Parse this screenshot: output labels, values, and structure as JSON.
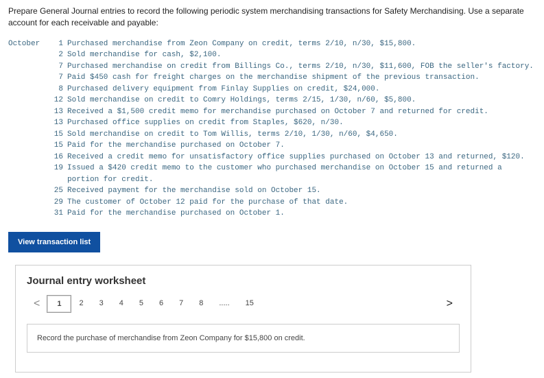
{
  "intro": "Prepare General Journal entries to record the following periodic system merchandising transactions for Safety Merchandising. Use a separate account for each receivable and payable:",
  "transactions": [
    {
      "month": "October",
      "day": "1",
      "text": "Purchased merchandise from Zeon Company on credit, terms 2/10, n/30, $15,800."
    },
    {
      "month": "",
      "day": "2",
      "text": "Sold merchandise for cash, $2,100."
    },
    {
      "month": "",
      "day": "7",
      "text": "Purchased merchandise on credit from Billings Co., terms 2/10, n/30, $11,600, FOB the seller's factory."
    },
    {
      "month": "",
      "day": "7",
      "text": "Paid $450 cash for freight charges on the merchandise shipment of the previous transaction."
    },
    {
      "month": "",
      "day": "8",
      "text": "Purchased delivery equipment from Finlay Supplies on credit, $24,000."
    },
    {
      "month": "",
      "day": "12",
      "text": "Sold merchandise on credit to Comry Holdings, terms 2/15, 1/30, n/60, $5,800."
    },
    {
      "month": "",
      "day": "13",
      "text": "Received a $1,500 credit memo for merchandise purchased on October 7 and returned for credit."
    },
    {
      "month": "",
      "day": "13",
      "text": "Purchased office supplies on credit from Staples, $620, n/30."
    },
    {
      "month": "",
      "day": "15",
      "text": "Sold merchandise on credit to Tom Willis, terms 2/10, 1/30, n/60, $4,650."
    },
    {
      "month": "",
      "day": "15",
      "text": "Paid for the merchandise purchased on October 7."
    },
    {
      "month": "",
      "day": "16",
      "text": "Received a credit memo for unsatisfactory office supplies purchased on October 13 and returned, $120."
    },
    {
      "month": "",
      "day": "19",
      "text": "Issued a $420 credit memo to the customer who purchased merchandise on October 15 and returned a portion for credit."
    },
    {
      "month": "",
      "day": "25",
      "text": "Received payment for the merchandise sold on October 15."
    },
    {
      "month": "",
      "day": "29",
      "text": "The customer of October 12 paid for the purchase of that date."
    },
    {
      "month": "",
      "day": "31",
      "text": "Paid for the merchandise purchased on October 1."
    }
  ],
  "view_button": "View transaction list",
  "worksheet_title": "Journal entry worksheet",
  "tabs": [
    "1",
    "2",
    "3",
    "4",
    "5",
    "6",
    "7",
    "8",
    ".....",
    "15"
  ],
  "arrows": {
    "left": "<",
    "right": ">"
  },
  "instruction": "Record the purchase of merchandise from Zeon Company for $15,800 on credit."
}
